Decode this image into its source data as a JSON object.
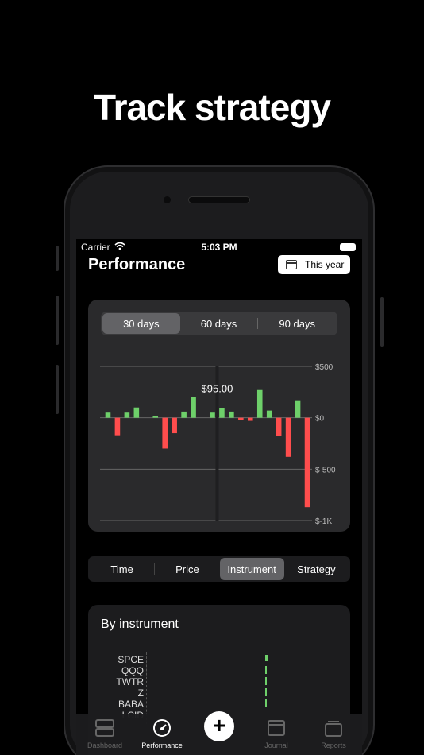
{
  "headline": "Track strategy",
  "status": {
    "carrier": "Carrier",
    "time": "5:03 PM"
  },
  "header": {
    "title": "Performance",
    "period_label": "This year"
  },
  "range": {
    "options": [
      "30 days",
      "60 days",
      "90 days"
    ],
    "selected": "30 days"
  },
  "chart_data": {
    "type": "bar",
    "ylim": [
      -1000,
      500
    ],
    "ytick_labels": [
      "$500",
      "$0",
      "$-500",
      "$-1K"
    ],
    "yticks": [
      500,
      0,
      -500,
      -1000
    ],
    "highlight_label": "$95.00",
    "values": [
      50,
      -170,
      50,
      100,
      0,
      15,
      -300,
      -150,
      60,
      200,
      0,
      50,
      95,
      60,
      -20,
      -30,
      270,
      70,
      -180,
      -380,
      170,
      -870
    ],
    "colors": {
      "positive": "#6ed06a",
      "negative": "#ff4d4d"
    }
  },
  "analysis_tabs": {
    "items": [
      "Time",
      "Price",
      "Instrument",
      "Strategy"
    ],
    "selected": "Instrument"
  },
  "instrument_card": {
    "title": "By instrument",
    "rows": [
      "SPCE",
      "QQQ",
      "TWTR",
      "Z",
      "BABA",
      "LCID"
    ]
  },
  "tabbar": {
    "items": [
      {
        "label": "Dashboard",
        "icon": "dashboard-icon"
      },
      {
        "label": "Performance",
        "icon": "gauge-icon"
      },
      {
        "label": "",
        "icon": "add-icon"
      },
      {
        "label": "Journal",
        "icon": "calendar-icon"
      },
      {
        "label": "Reports",
        "icon": "stack-icon"
      }
    ]
  }
}
